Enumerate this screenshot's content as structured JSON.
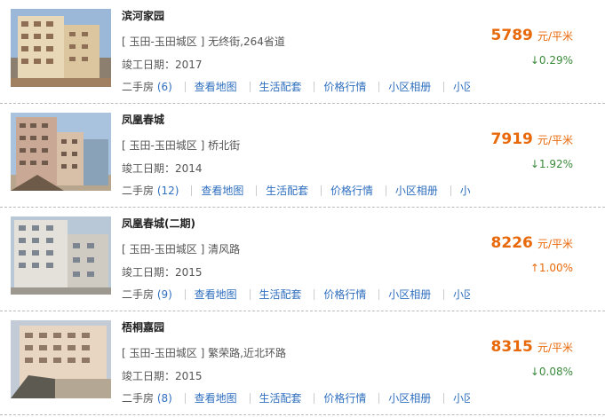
{
  "listings": [
    {
      "name": "滨河家园",
      "location": "[ 玉田-玉田城区 ] 无终街,264省道",
      "completion": "竣工日期：2017",
      "price": "5789",
      "unit": "元/平米",
      "trend": "down",
      "change": "↓0.29%",
      "links": {
        "second_hand": "二手房",
        "count": "(6)",
        "map": "查看地图",
        "life": "生活配套",
        "price_trend": "价格行情",
        "album": "小区相册",
        "more": "小区"
      }
    },
    {
      "name": "凤凰春城",
      "location": "[ 玉田-玉田城区 ] 桥北街",
      "completion": "竣工日期：2014",
      "price": "7919",
      "unit": "元/平米",
      "trend": "down",
      "change": "↓1.92%",
      "links": {
        "second_hand": "二手房",
        "count": "(12)",
        "map": "查看地图",
        "life": "生活配套",
        "price_trend": "价格行情",
        "album": "小区相册",
        "more": "小区"
      }
    },
    {
      "name": "凤凰春城(二期)",
      "location": "[ 玉田-玉田城区 ] 清风路",
      "completion": "竣工日期：2015",
      "price": "8226",
      "unit": "元/平米",
      "trend": "up",
      "change": "↑1.00%",
      "links": {
        "second_hand": "二手房",
        "count": "(9)",
        "map": "查看地图",
        "life": "生活配套",
        "price_trend": "价格行情",
        "album": "小区相册",
        "more": "小区"
      }
    },
    {
      "name": "梧桐嘉园",
      "location": "[ 玉田-玉田城区 ] 繁荣路,近北环路",
      "completion": "竣工日期：2015",
      "price": "8315",
      "unit": "元/平米",
      "trend": "down",
      "change": "↓0.08%",
      "links": {
        "second_hand": "二手房",
        "count": "(8)",
        "map": "查看地图",
        "life": "生活配套",
        "price_trend": "价格行情",
        "album": "小区相册",
        "more": "小区"
      }
    }
  ]
}
